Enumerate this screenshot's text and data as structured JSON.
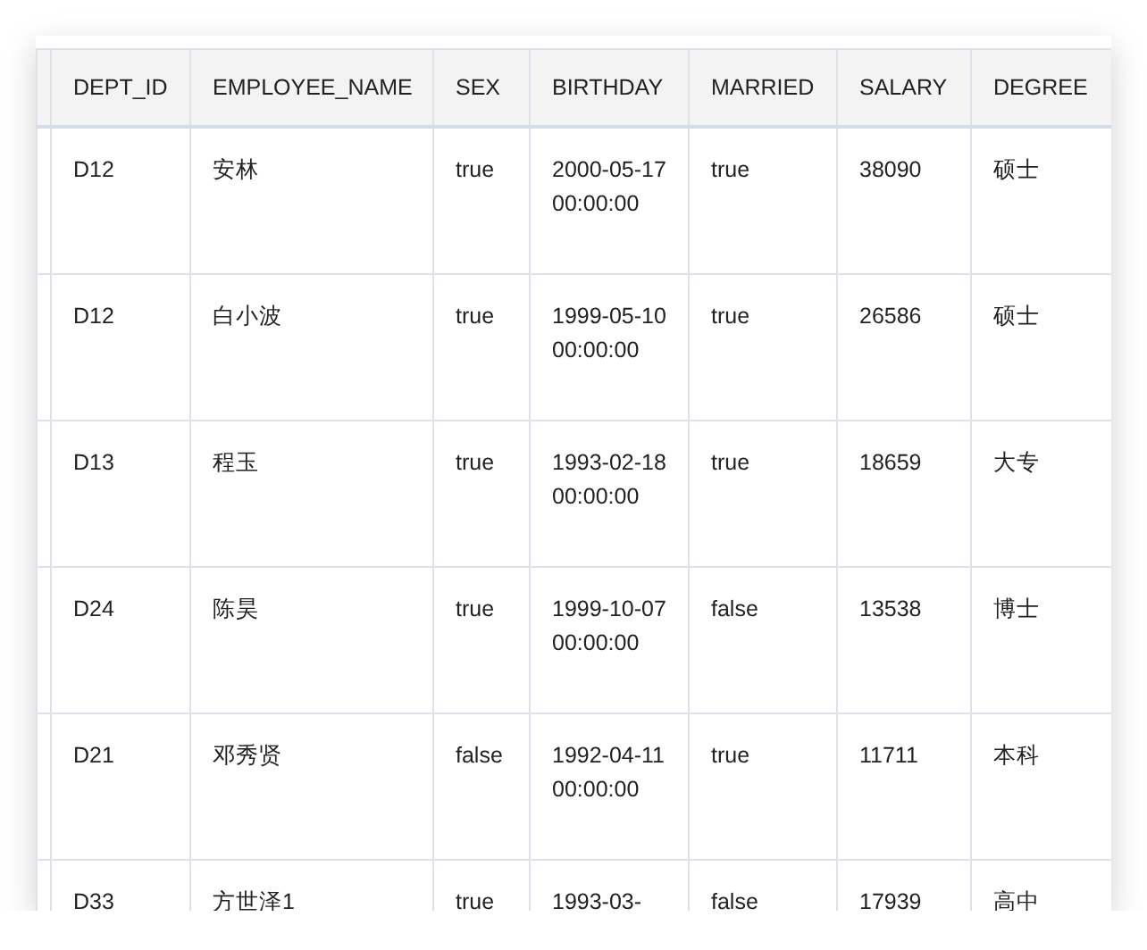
{
  "table": {
    "columns": [
      "DEPT_ID",
      "EMPLOYEE_NAME",
      "SEX",
      "BIRTHDAY",
      "MARRIED",
      "SALARY",
      "DEGREE"
    ],
    "rows": [
      [
        "D12",
        "安林",
        "true",
        "2000-05-17 00:00:00",
        "true",
        "38090",
        "硕士"
      ],
      [
        "D12",
        "白小波",
        "true",
        "1999-05-10 00:00:00",
        "true",
        "26586",
        "硕士"
      ],
      [
        "D13",
        "程玉",
        "true",
        "1993-02-18 00:00:00",
        "true",
        "18659",
        "大专"
      ],
      [
        "D24",
        "陈昊",
        "true",
        "1999-10-07 00:00:00",
        "false",
        "13538",
        "博士"
      ],
      [
        "D21",
        "邓秀贤",
        "false",
        "1992-04-11 00:00:00",
        "true",
        "11711",
        "本科"
      ],
      [
        "D33",
        "方世泽1",
        "true",
        "1993-03-",
        "false",
        "17939",
        "高中"
      ]
    ]
  }
}
